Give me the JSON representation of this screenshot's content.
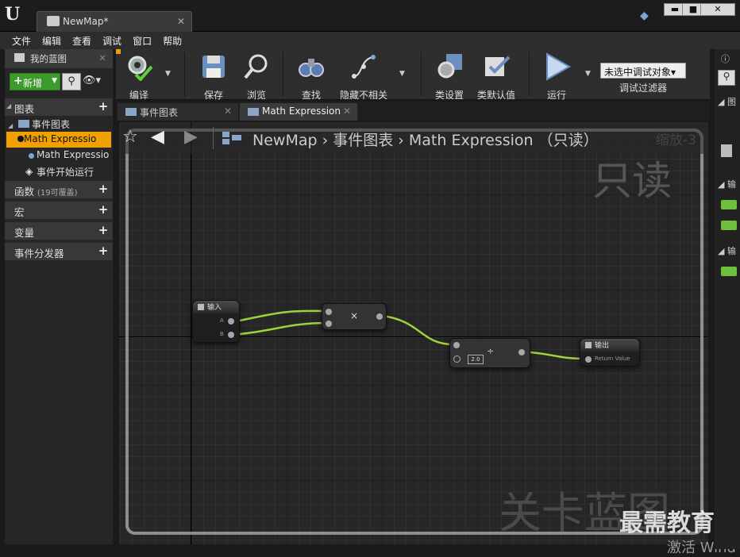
{
  "titlebar": {
    "tab_label": "NewMap*",
    "minimize": "▬",
    "maximize": "■",
    "close": "✕"
  },
  "menu": [
    "文件",
    "编辑",
    "查看",
    "调试",
    "窗口",
    "帮助"
  ],
  "left_panel": {
    "tab_label": "我的蓝图",
    "add_label": "新增",
    "categories": {
      "graphs": "图表",
      "functions": "函数",
      "functions_note": "(19可覆盖)",
      "macros": "宏",
      "variables": "变量",
      "dispatchers": "事件分发器"
    },
    "tree": {
      "event_graph": "事件图表",
      "item1": "Math Expressio",
      "item2": "Math Expressio",
      "item3": "事件开始运行"
    }
  },
  "toolbar": {
    "compile": "编译",
    "save": "保存",
    "browse": "浏览",
    "find": "查找",
    "hide_unrelated": "隐藏不相关",
    "class_settings": "类设置",
    "class_defaults": "类默认值",
    "run": "运行",
    "debug_object": "未选中调试对象▾",
    "debug_filter": "调试过滤器"
  },
  "graph_tabs": [
    {
      "label": "事件图表"
    },
    {
      "label": "Math Expression"
    }
  ],
  "graph": {
    "breadcrumb": "NewMap ›  事件图表   ›   Math Expression （只读）",
    "zoom": "缩放-3",
    "readonly": "只读",
    "level_watermark": "关卡蓝图"
  },
  "nodes": {
    "input_title": "输入",
    "input_pin_a": "A",
    "input_pin_b": "B",
    "multiply_op": "×",
    "divide_op": "÷",
    "divide_const": "2.0",
    "output_title": "输出",
    "output_pin": "Return Value"
  },
  "watermarks": {
    "brand": "最需教育",
    "activate": "激活 Wind"
  },
  "colors": {
    "wire": "#9ed23a",
    "accent": "#f0a000",
    "add_button": "#3d9a2c"
  }
}
